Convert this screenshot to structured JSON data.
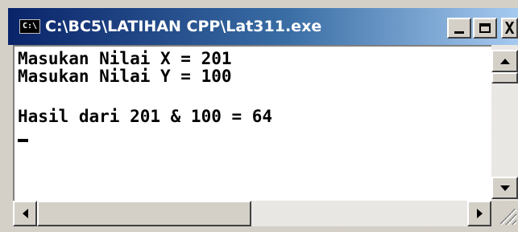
{
  "window": {
    "title": "C:\\BC5\\LATIHAN CPP\\Lat311.exe",
    "icon_text": "C:\\",
    "icon": "console-icon",
    "buttons": {
      "minimize": "minimize-icon",
      "maximize": "maximize-icon",
      "close_glyph": "X"
    }
  },
  "console": {
    "lines": [
      "Masukan Nilai X = 201",
      "Masukan Nilai Y = 100",
      "Hasil dari 201 & 100 = 64"
    ],
    "cursor": "_"
  },
  "colors": {
    "titlebar_start": "#0a246a",
    "titlebar_end": "#a6caf0",
    "console_bg": "#ffffff",
    "console_text": "#000000",
    "chrome": "#d4d0c8"
  }
}
